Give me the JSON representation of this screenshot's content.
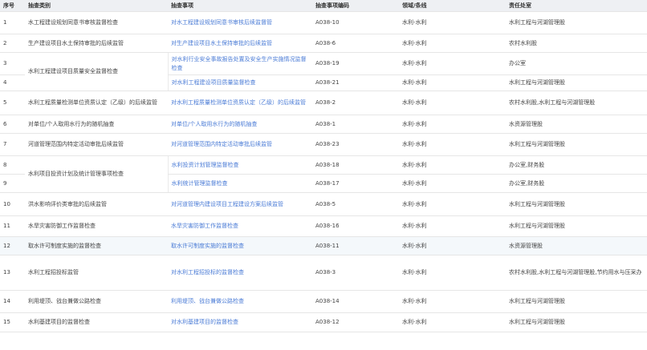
{
  "table": {
    "headers": {
      "no": "序号",
      "category": "抽查类别",
      "item": "抽查事项",
      "code": "抽查事项编码",
      "field": "领域/条线",
      "dept": "责任处室"
    },
    "rows": [
      {
        "no": "1",
        "category": "水工程建设规划同意书审核监督检查",
        "item": "对水工程建设规划同意书审核后续监督管",
        "code": "A038-10",
        "field": "水利-水利",
        "dept": "水利工程与河湖管理股"
      },
      {
        "no": "2",
        "category": "生产建设项目水土保持审批的后续监管",
        "item": "对生产建设项目水土保持审批的后续监管",
        "code": "A038-6",
        "field": "水利-水利",
        "dept": "农村水利股"
      },
      {
        "no": "3",
        "category": "水利工程建设项目质量安全监督检查",
        "item": "对水利行业安全事故报告处置及安全生产实施情况监督检查",
        "code": "A038-19",
        "field": "水利-水利",
        "dept": "办公室"
      },
      {
        "no": "4",
        "category": "",
        "item": "对水利工程建设项目质量监督检查",
        "code": "A038-21",
        "field": "水利-水利",
        "dept": "水利工程与河湖管理股"
      },
      {
        "no": "5",
        "category": "水利工程质量检测单位资质认定（乙级）的后续监管",
        "item": "对水利工程质量检测单位资质认定（乙级）的后续监管",
        "code": "A038-2",
        "field": "水利-水利",
        "dept": "农村水利股,水利工程与河湖管理股"
      },
      {
        "no": "6",
        "category": "对单位/个人取用水行为的随机抽查",
        "item": "对单位/个人取用水行为的随机抽查",
        "code": "A038-1",
        "field": "水利-水利",
        "dept": "水资源管理股"
      },
      {
        "no": "7",
        "category": "河道管理范围内特定活动审批后续监管",
        "item": "对河道管理范围内特定活动审批后续监管",
        "code": "A038-23",
        "field": "水利-水利",
        "dept": "水利工程与河湖管理股"
      },
      {
        "no": "8",
        "category": "水利项目投资计划及统计管理事项检查",
        "item": "水利投资计划管理监督检查",
        "code": "A038-18",
        "field": "水利-水利",
        "dept": "办公室,财务股"
      },
      {
        "no": "9",
        "category": "",
        "item": "水利统计管理监督检查",
        "code": "A038-17",
        "field": "水利-水利",
        "dept": "办公室,财务股"
      },
      {
        "no": "10",
        "category": "洪水影响评价类审批的后续监管",
        "item": "对河道管理内建设项目工程建设方案后续监管",
        "code": "A038-5",
        "field": "水利-水利",
        "dept": "水利工程与河湖管理股"
      },
      {
        "no": "11",
        "category": "水旱灾害防御工作监督检查",
        "item": "水旱灾害防御工作监督检查",
        "code": "A038-16",
        "field": "水利-水利",
        "dept": "水利工程与河湖管理股"
      },
      {
        "no": "12",
        "category": "取水许可制度实施的监督检查",
        "item": "取水许可制度实施的监督检查",
        "code": "A038-11",
        "field": "水利-水利",
        "dept": "水资源管理股"
      },
      {
        "no": "13",
        "category": "水利工程招投标监管",
        "item": "对水利工程招投标的监督检查",
        "code": "A038-3",
        "field": "水利-水利",
        "dept": "农村水利股,水利工程与河湖管理股,节约用水与压采办"
      },
      {
        "no": "14",
        "category": "利用堤顶、戗台兼做公路检查",
        "item": "利用堤顶、戗台兼做公路检查",
        "code": "A038-14",
        "field": "水利-水利",
        "dept": "水利工程与河湖管理股"
      },
      {
        "no": "15",
        "category": "水利基建项目的监督检查",
        "item": "对水利基建项目的监督检查",
        "code": "A038-12",
        "field": "水利-水利",
        "dept": "水利工程与河湖管理股"
      }
    ]
  }
}
